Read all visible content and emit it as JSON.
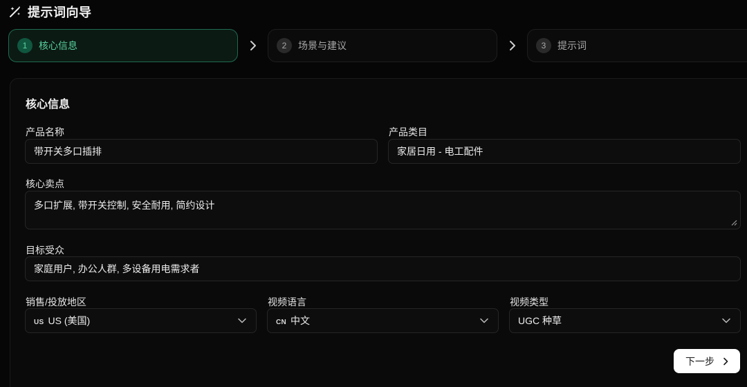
{
  "header": {
    "title": "提示词向导",
    "icon": "magic-wand-icon"
  },
  "steps": [
    {
      "number": "1",
      "label": "核心信息",
      "active": true
    },
    {
      "number": "2",
      "label": "场景与建议",
      "active": false
    },
    {
      "number": "3",
      "label": "提示词",
      "active": false
    }
  ],
  "section": {
    "title": "核心信息"
  },
  "form": {
    "product_name": {
      "label": "产品名称",
      "value": "带开关多口插排"
    },
    "product_category": {
      "label": "产品类目",
      "value": "家居日用 - 电工配件"
    },
    "selling_points": {
      "label": "核心卖点",
      "value": "多口扩展, 带开关控制, 安全耐用, 简约设计"
    },
    "target_audience": {
      "label": "目标受众",
      "value": "家庭用户, 办公人群, 多设备用电需求者"
    },
    "region": {
      "label": "销售/投放地区",
      "flag": "US",
      "value": "US (美国)"
    },
    "language": {
      "label": "视频语言",
      "flag": "CN",
      "value": "中文"
    },
    "video_type": {
      "label": "视频类型",
      "value": "UGC 种草"
    }
  },
  "actions": {
    "next_label": "下一步"
  },
  "colors": {
    "accent": "#56cf9a",
    "active_border": "#1f6b4f",
    "background": "#060606"
  }
}
